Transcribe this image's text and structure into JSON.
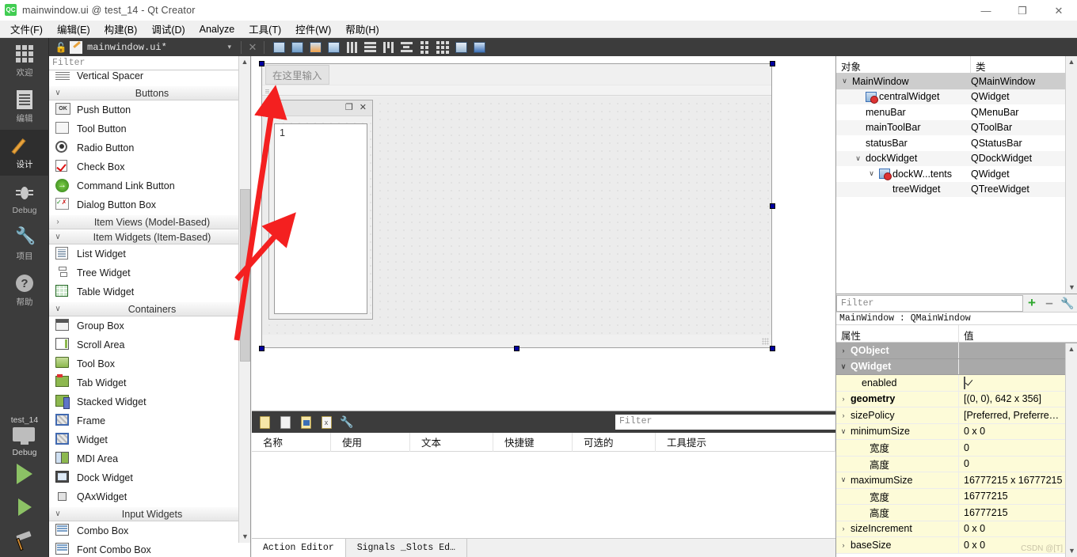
{
  "window": {
    "title": "mainwindow.ui @ test_14 - Qt Creator",
    "logo_text": "QC",
    "controls": {
      "minimize": "—",
      "restore": "❐",
      "close": "✕"
    }
  },
  "menubar": {
    "items": [
      {
        "label": "文件(F)"
      },
      {
        "label": "编辑(E)"
      },
      {
        "label": "构建(B)"
      },
      {
        "label": "调试(D)"
      },
      {
        "label": "Analyze"
      },
      {
        "label": "工具(T)"
      },
      {
        "label": "控件(W)"
      },
      {
        "label": "帮助(H)"
      }
    ]
  },
  "modebar": {
    "items": [
      {
        "label": "欢迎",
        "icon": "grid-icon",
        "active": false
      },
      {
        "label": "编辑",
        "icon": "document-icon",
        "active": false
      },
      {
        "label": "设计",
        "icon": "pencil-icon",
        "active": true
      },
      {
        "label": "Debug",
        "icon": "bug-icon",
        "active": false
      },
      {
        "label": "项目",
        "icon": "wrench-icon",
        "active": false
      },
      {
        "label": "帮助",
        "icon": "help-icon",
        "active": false
      }
    ],
    "kit": {
      "project": "test_14",
      "build_config": "Debug",
      "run_label": "run-button",
      "debug_label": "debug-button",
      "build_label": "build-button"
    }
  },
  "file_toolbar": {
    "filename": "mainwindow.ui*",
    "dropdown_arrow": "▾",
    "close_label": "✕",
    "lock_icon": "lock-open-icon",
    "designer_tools": [
      "edit-widgets-icon",
      "edit-signals-slots-icon",
      "edit-buddies-icon",
      "edit-tab-order-icon",
      "layout-horizontally-icon",
      "layout-vertically-icon",
      "layout-splitter-horizontal-icon",
      "layout-splitter-vertical-icon",
      "layout-form-icon",
      "layout-grid-icon",
      "break-layout-icon",
      "adjust-size-icon"
    ]
  },
  "widget_box": {
    "filter_placeholder": "Filter",
    "entries": [
      {
        "type": "item",
        "label": "Vertical Spacer",
        "icon": "vertical-spacer-icon",
        "partial": true
      },
      {
        "type": "category",
        "label": "Buttons",
        "expanded": true
      },
      {
        "type": "item",
        "label": "Push Button",
        "icon": "push-button-icon"
      },
      {
        "type": "item",
        "label": "Tool Button",
        "icon": "tool-button-icon"
      },
      {
        "type": "item",
        "label": "Radio Button",
        "icon": "radio-button-icon"
      },
      {
        "type": "item",
        "label": "Check Box",
        "icon": "check-box-icon"
      },
      {
        "type": "item",
        "label": "Command Link Button",
        "icon": "command-link-button-icon"
      },
      {
        "type": "item",
        "label": "Dialog Button Box",
        "icon": "dialog-button-box-icon"
      },
      {
        "type": "category",
        "label": "Item Views (Model-Based)",
        "expanded": false
      },
      {
        "type": "category",
        "label": "Item Widgets (Item-Based)",
        "expanded": true
      },
      {
        "type": "item",
        "label": "List Widget",
        "icon": "list-widget-icon"
      },
      {
        "type": "item",
        "label": "Tree Widget",
        "icon": "tree-widget-icon"
      },
      {
        "type": "item",
        "label": "Table Widget",
        "icon": "table-widget-icon"
      },
      {
        "type": "category",
        "label": "Containers",
        "expanded": true
      },
      {
        "type": "item",
        "label": "Group Box",
        "icon": "group-box-icon"
      },
      {
        "type": "item",
        "label": "Scroll Area",
        "icon": "scroll-area-icon"
      },
      {
        "type": "item",
        "label": "Tool Box",
        "icon": "tool-box-icon"
      },
      {
        "type": "item",
        "label": "Tab Widget",
        "icon": "tab-widget-icon"
      },
      {
        "type": "item",
        "label": "Stacked Widget",
        "icon": "stacked-widget-icon"
      },
      {
        "type": "item",
        "label": "Frame",
        "icon": "frame-icon"
      },
      {
        "type": "item",
        "label": "Widget",
        "icon": "widget-icon"
      },
      {
        "type": "item",
        "label": "MDI Area",
        "icon": "mdi-area-icon"
      },
      {
        "type": "item",
        "label": "Dock Widget",
        "icon": "dock-widget-icon"
      },
      {
        "type": "item",
        "label": "QAxWidget",
        "icon": "qax-widget-icon"
      },
      {
        "type": "category",
        "label": "Input Widgets",
        "expanded": true
      },
      {
        "type": "item",
        "label": "Combo Box",
        "icon": "combo-box-icon"
      },
      {
        "type": "item",
        "label": "Font Combo Box",
        "icon": "font-combo-box-icon",
        "partial": true
      }
    ]
  },
  "form": {
    "menu_placeholder": "在这里输入",
    "dock": {
      "float_icon": "float-icon",
      "close_icon": "close-icon",
      "tree_item": "1"
    }
  },
  "action_editor": {
    "filter_placeholder": "Filter",
    "toolbar_icons": [
      "new-action-icon",
      "copy-action-icon",
      "paste-action-icon",
      "delete-action-icon",
      "view-options-icon"
    ],
    "columns": [
      "名称",
      "使用",
      "文本",
      "快捷键",
      "可选的",
      "工具提示"
    ],
    "rows": [],
    "tabs": [
      {
        "label": "Action Editor",
        "active": true
      },
      {
        "label": "Signals _Slots Ed…",
        "active": false
      }
    ]
  },
  "object_inspector": {
    "columns": [
      "对象",
      "类"
    ],
    "rows": [
      {
        "name": "MainWindow",
        "class": "QMainWindow",
        "indent": 0,
        "chevron": "down",
        "icon": null,
        "selected": true
      },
      {
        "name": "centralWidget",
        "class": "QWidget",
        "indent": 1,
        "chevron": null,
        "icon": "widget-icon"
      },
      {
        "name": "menuBar",
        "class": "QMenuBar",
        "indent": 1,
        "chevron": null,
        "icon": null
      },
      {
        "name": "mainToolBar",
        "class": "QToolBar",
        "indent": 1,
        "chevron": null,
        "icon": null
      },
      {
        "name": "statusBar",
        "class": "QStatusBar",
        "indent": 1,
        "chevron": null,
        "icon": null
      },
      {
        "name": "dockWidget",
        "class": "QDockWidget",
        "indent": 1,
        "chevron": "down",
        "icon": null
      },
      {
        "name": "dockW...tents",
        "class": "QWidget",
        "indent": 2,
        "chevron": "down",
        "icon": "widget-icon"
      },
      {
        "name": "treeWidget",
        "class": "QTreeWidget",
        "indent": 3,
        "chevron": null,
        "icon": null
      }
    ]
  },
  "property_editor": {
    "filter_placeholder": "Filter",
    "add_icon": "plus-icon",
    "remove_icon": "minus-icon",
    "config_icon": "wrench-icon",
    "object_line": "MainWindow : QMainWindow",
    "columns": [
      "属性",
      "值"
    ],
    "rows": [
      {
        "name": "QObject",
        "value": "",
        "kind": "group",
        "chevron": "right"
      },
      {
        "name": "QWidget",
        "value": "",
        "kind": "group",
        "chevron": "down"
      },
      {
        "name": "enabled",
        "value": "",
        "kind": "value",
        "chevron": null,
        "checkbox": true,
        "indent": 1
      },
      {
        "name": "geometry",
        "value": "[(0, 0), 642 x 356]",
        "kind": "value",
        "chevron": "right",
        "bold": true
      },
      {
        "name": "sizePolicy",
        "value": "[Preferred, Preferre…",
        "kind": "value",
        "chevron": "right"
      },
      {
        "name": "minimumSize",
        "value": "0 x 0",
        "kind": "value",
        "chevron": "down"
      },
      {
        "name": "宽度",
        "value": "0",
        "kind": "value",
        "chevron": null,
        "indent": 2
      },
      {
        "name": "高度",
        "value": "0",
        "kind": "value",
        "chevron": null,
        "indent": 2
      },
      {
        "name": "maximumSize",
        "value": "16777215 x 16777215",
        "kind": "value",
        "chevron": "down"
      },
      {
        "name": "宽度",
        "value": "16777215",
        "kind": "value",
        "chevron": null,
        "indent": 2
      },
      {
        "name": "高度",
        "value": "16777215",
        "kind": "value",
        "chevron": null,
        "indent": 2
      },
      {
        "name": "sizeIncrement",
        "value": "0 x 0",
        "kind": "value",
        "chevron": "right"
      },
      {
        "name": "baseSize",
        "value": "0 x 0",
        "kind": "value",
        "chevron": "right"
      }
    ]
  },
  "watermark": {
    "text": "CSDN @[T]"
  },
  "colors": {
    "accent_orange": "#e8a33d",
    "dark_chrome": "#3c3c3c",
    "property_yellow": "#fdfbd8",
    "selection_gray": "#cdcdcd",
    "annotation_red": "#f42020",
    "qt_green": "#41cd52"
  }
}
